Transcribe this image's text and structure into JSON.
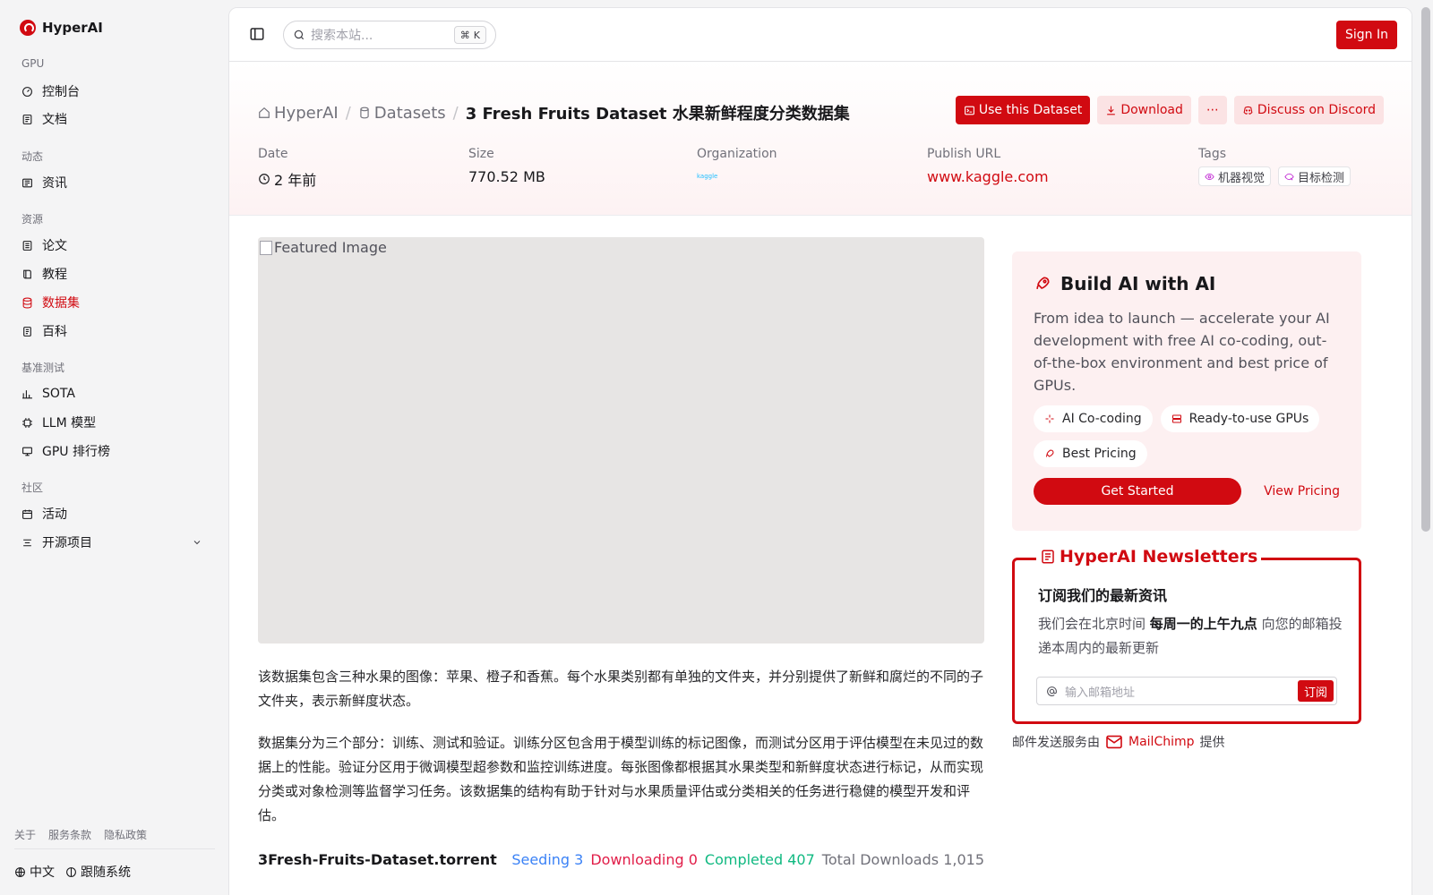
{
  "brand": {
    "name": "HyperAI"
  },
  "sidebar": {
    "sections": [
      {
        "label": "GPU",
        "items": [
          {
            "label": "控制台",
            "icon": "gauge-icon"
          },
          {
            "label": "文档",
            "icon": "doc-icon"
          }
        ]
      },
      {
        "label": "动态",
        "items": [
          {
            "label": "资讯",
            "icon": "news-icon"
          }
        ]
      },
      {
        "label": "资源",
        "items": [
          {
            "label": "论文",
            "icon": "paper-icon"
          },
          {
            "label": "教程",
            "icon": "book-icon"
          },
          {
            "label": "数据集",
            "icon": "database-icon",
            "active": true
          },
          {
            "label": "百科",
            "icon": "wiki-icon"
          }
        ]
      },
      {
        "label": "基准测试",
        "items": [
          {
            "label": "SOTA",
            "icon": "chart-icon"
          },
          {
            "label": "LLM 模型",
            "icon": "chip-icon"
          },
          {
            "label": "GPU 排行榜",
            "icon": "monitor-icon"
          }
        ]
      },
      {
        "label": "社区",
        "items": [
          {
            "label": "活动",
            "icon": "calendar-icon"
          },
          {
            "label": "开源项目",
            "icon": "list-icon"
          }
        ]
      }
    ],
    "footer_links": [
      "关于",
      "服务条款",
      "隐私政策"
    ],
    "language": "中文",
    "tracking": "跟随系统"
  },
  "topbar": {
    "search_placeholder": "搜索本站...",
    "shortcut": "K",
    "signin": "Sign In"
  },
  "breadcrumb": {
    "home": "HyperAI",
    "section": "Datasets",
    "current": "3 Fresh Fruits Dataset 水果新鲜程度分类数据集"
  },
  "actions": {
    "use": "Use this Dataset",
    "download": "Download",
    "more": "⋯",
    "discord": "Discuss on Discord"
  },
  "meta": {
    "date_label": "Date",
    "date_value": "2 年前",
    "size_label": "Size",
    "size_value": "770.52 MB",
    "org_label": "Organization",
    "org_logo_text": "kaggle",
    "url_label": "Publish URL",
    "url_value": "www.kaggle.com",
    "tags_label": "Tags",
    "tags": [
      "机器视觉",
      "目标检测"
    ]
  },
  "featured": {
    "alt": "Featured Image"
  },
  "description": {
    "p1": "该数据集包含三种水果的图像：苹果、橙子和香蕉。每个水果类别都有单独的文件夹，并分别提供了新鲜和腐烂的不同的子文件夹，表示新鲜度状态。",
    "p2": "数据集分为三个部分：训练、测试和验证。训练分区包含用于模型训练的标记图像，而测试分区用于评估模型在未见过的数据上的性能。验证分区用于微调模型超参数和监控训练进度。每张图像都根据其水果类型和新鲜度状态进行标记，从而实现分类或对象检测等监督学习任务。该数据集的结构有助于针对与水果质量评估或分类相关的任务进行稳健的模型开发和评估。"
  },
  "torrent": {
    "name": "3Fresh-Fruits-Dataset.torrent",
    "seeding": "Seeding 3",
    "downloading": "Downloading 0",
    "completed": "Completed 407",
    "total": "Total Downloads 1,015"
  },
  "ai_card": {
    "title": "Build AI with AI",
    "desc": "From idea to launch — accelerate your AI development with free AI co-coding, out-of-the-box environment and best price of GPUs.",
    "chips": [
      "AI Co-coding",
      "Ready-to-use GPUs",
      "Best Pricing"
    ],
    "cta": "Get Started",
    "pricing": "View Pricing"
  },
  "newsletter": {
    "title": "HyperAI Newsletters",
    "heading": "订阅我们的最新资讯",
    "text_before": "我们会在北京时间 ",
    "text_bold": "每周一的上午九点",
    "text_after": " 向您的邮箱投递本周内的最新更新",
    "placeholder": "输入邮箱地址",
    "submit": "订阅",
    "powered_before": "邮件发送服务由",
    "powered_link": "MailChimp",
    "powered_after": "提供"
  },
  "colors": {
    "brand": "#d10a11",
    "seeding": "#3b82f6",
    "downloading": "#e11d48",
    "completed": "#10b981"
  }
}
